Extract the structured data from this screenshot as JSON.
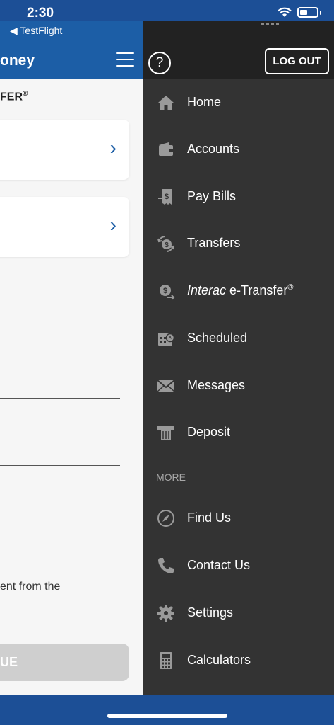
{
  "status_bar": {
    "time": "2:30"
  },
  "app": {
    "back_link": "◀ TestFlight",
    "title_partial": "oney",
    "section_title": "FER",
    "section_title_mark": "®",
    "note_partial": "ent from the",
    "button_partial": "UE"
  },
  "drawer": {
    "help": "?",
    "logout": "LOG OUT",
    "more": "MORE",
    "items": [
      {
        "label": "Home",
        "icon": "home-icon"
      },
      {
        "label": "Accounts",
        "icon": "wallet-icon"
      },
      {
        "label": "Pay Bills",
        "icon": "bill-icon"
      },
      {
        "label": "Transfers",
        "icon": "transfer-icon"
      },
      {
        "label_italic": "Interac",
        "label_rest": " e-Transfer",
        "label_mark": "®",
        "icon": "etransfer-icon"
      },
      {
        "label": "Scheduled",
        "icon": "calendar-icon"
      },
      {
        "label": "Messages",
        "icon": "envelope-icon"
      },
      {
        "label": "Deposit",
        "icon": "deposit-icon"
      },
      {
        "label": "Find Us",
        "icon": "compass-icon"
      },
      {
        "label": "Contact Us",
        "icon": "phone-icon"
      },
      {
        "label": "Settings",
        "icon": "gear-icon"
      },
      {
        "label": "Calculators",
        "icon": "calculator-icon"
      }
    ]
  },
  "colors": {
    "header_blue": "#1c5ea6",
    "drawer_bg": "#333333",
    "drawer_top": "#222222",
    "icon_gray": "#9a9a9a"
  }
}
